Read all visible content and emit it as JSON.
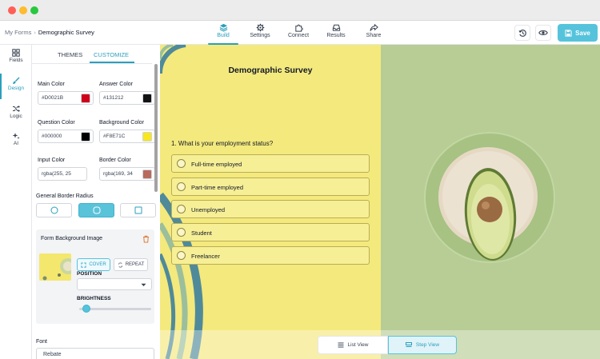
{
  "breadcrumb": {
    "root": "My Forms",
    "separator": "›",
    "current": "Demographic Survey"
  },
  "nav": {
    "tabs": [
      {
        "label": "Build",
        "icon": "layers-icon",
        "active": true
      },
      {
        "label": "Settings",
        "icon": "gear-icon",
        "active": false
      },
      {
        "label": "Connect",
        "icon": "puzzle-icon",
        "active": false
      },
      {
        "label": "Results",
        "icon": "inbox-icon",
        "active": false
      },
      {
        "label": "Share",
        "icon": "share-icon",
        "active": false
      }
    ],
    "save_label": "Save"
  },
  "rail": {
    "items": [
      {
        "label": "Fields",
        "icon": "grid-icon",
        "active": false
      },
      {
        "label": "Design",
        "icon": "brush-icon",
        "active": true
      },
      {
        "label": "Logic",
        "icon": "shuffle-icon",
        "active": false
      },
      {
        "label": "AI",
        "icon": "sparkle-icon",
        "active": false
      }
    ]
  },
  "panel": {
    "tabs": {
      "themes": "THEMES",
      "customize": "CUSTOMIZE"
    },
    "colors": {
      "main": {
        "label": "Main Color",
        "value": "#D0021B",
        "swatch": "#d0021b"
      },
      "answer": {
        "label": "Answer Color",
        "value": "#131212",
        "swatch": "#131212"
      },
      "question": {
        "label": "Question Color",
        "value": "#000000",
        "swatch": "#000000"
      },
      "background": {
        "label": "Background Color",
        "value": "#F8E71C",
        "swatch": "#f8e71c"
      },
      "input": {
        "label": "Input Color",
        "value": "rgba(255, 25",
        "swatch": "#ffffff"
      },
      "border": {
        "label": "Border Color",
        "value": "rgba(169, 34",
        "swatch": "#b86b5d"
      }
    },
    "border_radius_label": "General Border Radius",
    "bg_image": {
      "label": "Form Background Image",
      "cover": "COVER",
      "repeat": "REPEAT",
      "position_label": "POSITION",
      "brightness_label": "BRIGHTNESS",
      "brightness": 0.05
    },
    "font": {
      "label": "Font",
      "value": "Rebate"
    }
  },
  "preview": {
    "title": "Demographic Survey",
    "question": "1. What is your employment status?",
    "options": [
      "Full-time employed",
      "Part-time employed",
      "Unemployed",
      "Student",
      "Freelancer"
    ],
    "view_toggle": {
      "list": "List View",
      "step": "Step View"
    }
  },
  "accent_color": "#2a9fbd"
}
